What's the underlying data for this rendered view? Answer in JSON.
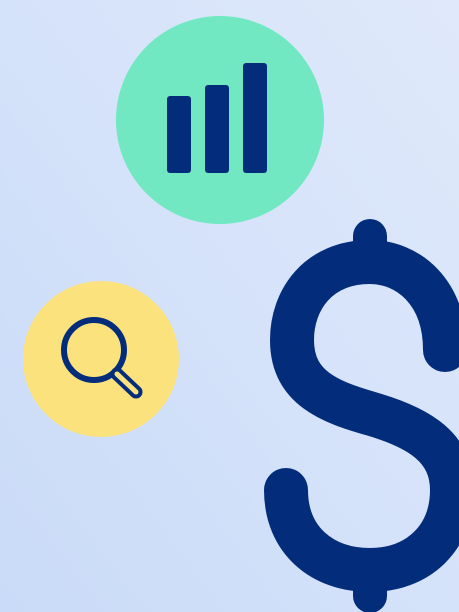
{
  "illustration": {
    "background": {
      "gradient_start": "#C9DBF8",
      "gradient_end": "#E0E9FB"
    },
    "icons": [
      {
        "name": "bar-chart-icon",
        "badge_color": "#71E8C1",
        "icon_color": "#032D7A"
      },
      {
        "name": "magnifier-icon",
        "badge_color": "#FBE27D",
        "icon_color": "#032D7A"
      },
      {
        "name": "dollar-sign-icon",
        "icon_color": "#032D7A"
      }
    ]
  }
}
